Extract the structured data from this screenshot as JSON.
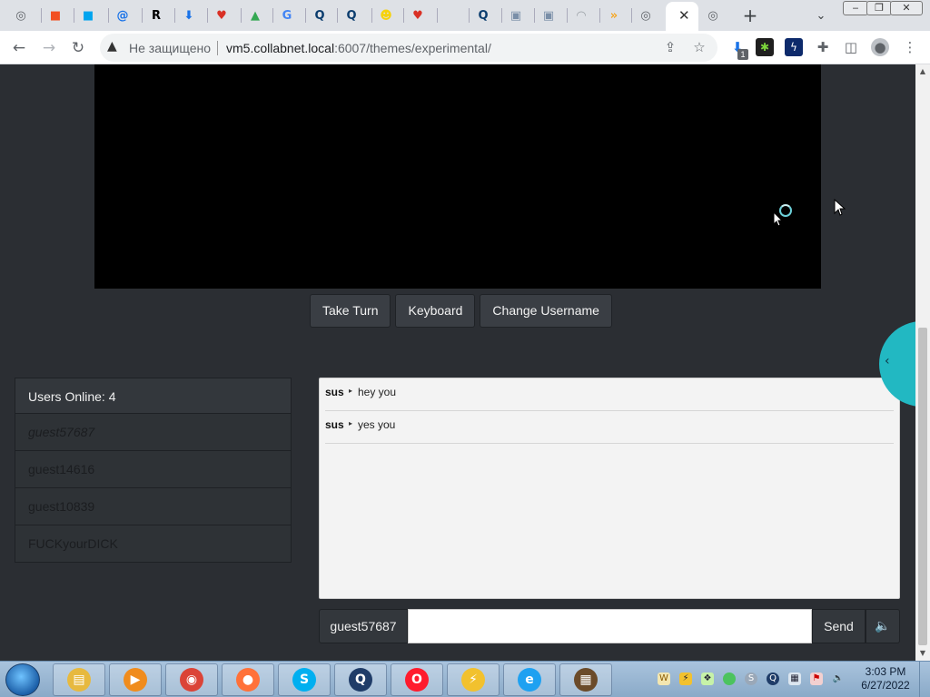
{
  "browser": {
    "active_tab_close": "✕",
    "new_tab": "+",
    "tab_search": "⌄",
    "insecure_label": "Не защищено",
    "url_host": "vm5.collabnet.local",
    "url_rest": ":6007/themes/experimental/",
    "download_badge": "1",
    "tabs": [
      {
        "icon": "chrome-icon",
        "color": "#5f6368",
        "glyph": "◎"
      },
      {
        "icon": "microsoft-icon",
        "color": "#f25022",
        "glyph": "■"
      },
      {
        "icon": "microsoft-icon",
        "color": "#00a4ef",
        "glyph": "■"
      },
      {
        "icon": "at-sign-icon",
        "color": "#1a73e8",
        "glyph": "@"
      },
      {
        "icon": "r-letter-icon",
        "color": "#000000",
        "glyph": "R"
      },
      {
        "icon": "download-icon",
        "color": "#1a73e8",
        "glyph": "⬇"
      },
      {
        "icon": "heart-app-icon",
        "color": "#d93025",
        "glyph": "♥"
      },
      {
        "icon": "drive-icon",
        "color": "#34a853",
        "glyph": "▲"
      },
      {
        "icon": "google-icon",
        "color": "#4285f4",
        "glyph": "G"
      },
      {
        "icon": "q-app-icon",
        "color": "#0b3d6e",
        "glyph": "Q"
      },
      {
        "icon": "q-app-icon",
        "color": "#0b3d6e",
        "glyph": "Q"
      },
      {
        "icon": "smiley-icon",
        "color": "#f6d20b",
        "glyph": "☻"
      },
      {
        "icon": "heart-app-icon",
        "color": "#d93025",
        "glyph": "♥"
      },
      {
        "icon": "blank-page-icon",
        "color": "#dee1e6",
        "glyph": ""
      },
      {
        "icon": "q-app-icon",
        "color": "#0b3d6e",
        "glyph": "Q"
      },
      {
        "icon": "box-icon",
        "color": "#7a8fa8",
        "glyph": "▣"
      },
      {
        "icon": "box-icon",
        "color": "#7a8fa8",
        "glyph": "▣"
      },
      {
        "icon": "wifi-icon",
        "color": "#9aa0a6",
        "glyph": "◠"
      },
      {
        "icon": "chevron-app-icon",
        "color": "#f5a623",
        "glyph": "»"
      },
      {
        "icon": "chrome-icon",
        "color": "#5f6368",
        "glyph": "◎"
      }
    ]
  },
  "vm": {
    "buttons": {
      "take_turn": "Take Turn",
      "keyboard": "Keyboard",
      "change_username": "Change Username"
    }
  },
  "users": {
    "header": "Users Online: 4",
    "list": [
      {
        "name": "guest57687"
      },
      {
        "name": "guest14616"
      },
      {
        "name": "guest10839"
      },
      {
        "name": "FUCKyourDICK"
      }
    ]
  },
  "chat": {
    "messages": [
      {
        "user": "sus",
        "text": "hey you"
      },
      {
        "user": "sus",
        "text": "yes you"
      }
    ],
    "my_username": "guest57687",
    "input_value": "",
    "send_label": "Send",
    "volume_icon": "speaker-icon"
  },
  "taskbar": {
    "apps": [
      {
        "icon": "file-explorer-icon",
        "color": "#e7b93f",
        "glyph": "▤"
      },
      {
        "icon": "media-player-icon",
        "color": "#f08c1d",
        "glyph": "▶"
      },
      {
        "icon": "chrome-icon",
        "color": "#db4437",
        "glyph": "◉"
      },
      {
        "icon": "firefox-icon",
        "color": "#ff7139",
        "glyph": "●"
      },
      {
        "icon": "skype-icon",
        "color": "#00aff0",
        "glyph": "S"
      },
      {
        "icon": "q-app-icon",
        "color": "#1f3c68",
        "glyph": "Q"
      },
      {
        "icon": "opera-icon",
        "color": "#ff1b2d",
        "glyph": "O"
      },
      {
        "icon": "lightning-app-icon",
        "color": "#f2c12e",
        "glyph": "⚡"
      },
      {
        "icon": "internet-explorer-icon",
        "color": "#1ea1f1",
        "glyph": "e"
      },
      {
        "icon": "minecraft-icon",
        "color": "#6b4b2a",
        "glyph": "▦"
      }
    ],
    "time": "3:03 PM",
    "date": "6/27/2022"
  },
  "colors": {
    "page_bg": "#2b2e33",
    "accent": "#22b8c2"
  }
}
